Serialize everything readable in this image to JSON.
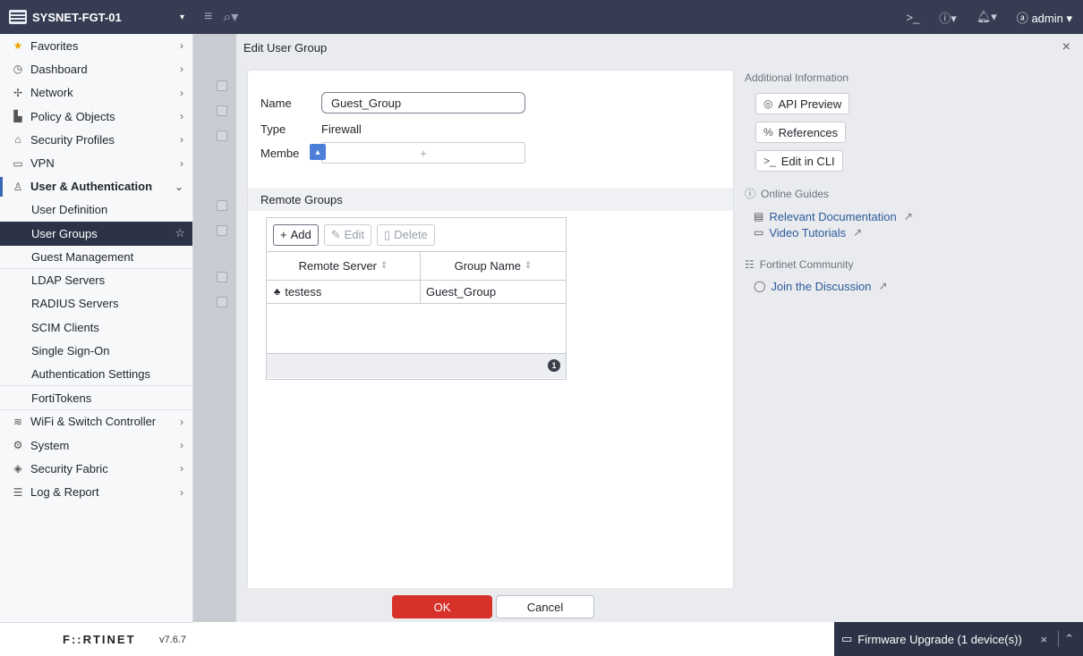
{
  "topbar": {
    "device_name": "SYSNET-FGT-01",
    "admin_label": "admin"
  },
  "sidebar": {
    "items": [
      {
        "label": "Favorites",
        "icon": "star-icon"
      },
      {
        "label": "Dashboard",
        "icon": "dashboard-icon"
      },
      {
        "label": "Network",
        "icon": "network-icon"
      },
      {
        "label": "Policy & Objects",
        "icon": "policy-icon"
      },
      {
        "label": "Security Profiles",
        "icon": "lock-icon"
      },
      {
        "label": "VPN",
        "icon": "monitor-icon"
      },
      {
        "label": "User & Authentication",
        "icon": "user-icon"
      }
    ],
    "sub_items": [
      "User Definition",
      "User Groups",
      "Guest Management",
      "LDAP Servers",
      "RADIUS Servers",
      "SCIM Clients",
      "Single Sign-On",
      "Authentication Settings",
      "FortiTokens"
    ],
    "bottom_items": [
      {
        "label": "WiFi & Switch Controller",
        "icon": "wifi-icon"
      },
      {
        "label": "System",
        "icon": "gear-icon"
      },
      {
        "label": "Security Fabric",
        "icon": "fabric-icon"
      },
      {
        "label": "Log & Report",
        "icon": "log-icon"
      }
    ],
    "brand": "F::RTINET",
    "version": "v7.6.7"
  },
  "modal": {
    "title": "Edit User Group",
    "form": {
      "name_label": "Name",
      "name_value": "Guest_Group",
      "type_label": "Type",
      "type_value": "Firewall",
      "members_label": "Membe",
      "members_placeholder": "+"
    },
    "remote_groups": {
      "title": "Remote Groups",
      "add_label": "Add",
      "edit_label": "Edit",
      "delete_label": "Delete",
      "columns": [
        "Remote Server",
        "Group Name"
      ],
      "rows": [
        {
          "server": "testess",
          "group": "Guest_Group"
        }
      ],
      "count": "1"
    },
    "info": {
      "heading": "Additional Information",
      "api_preview": "API Preview",
      "references": "References",
      "edit_cli": "Edit in CLI",
      "online_guides": "Online Guides",
      "relevant_docs": "Relevant Documentation",
      "video_tutorials": "Video Tutorials",
      "community": "Fortinet Community",
      "join_discussion": "Join the Discussion"
    },
    "ok_label": "OK",
    "cancel_label": "Cancel"
  },
  "firmware_notice": "Firmware Upgrade (1 device(s))",
  "colors": {
    "topbar_bg": "#363d52",
    "active_bg": "#2c3346",
    "ok_button": "#d7322a",
    "link": "#2d5a9b"
  }
}
